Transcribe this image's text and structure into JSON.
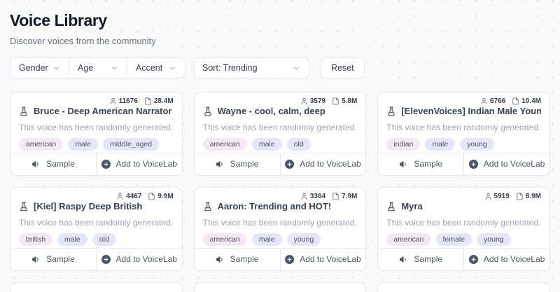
{
  "page": {
    "title": "Voice Library",
    "subtitle": "Discover voices from the community"
  },
  "filters": {
    "dropdowns": [
      {
        "label": "Gender"
      },
      {
        "label": "Age"
      },
      {
        "label": "Accent"
      }
    ],
    "sort": "Sort: Trending",
    "reset": "Reset"
  },
  "cards": {
    "description": "This voice has been randomly generated.",
    "sample_label": "Sample",
    "add_label": "Add to VoiceLab"
  },
  "voices": [
    {
      "name": "Bruce - Deep American Narrator Voice",
      "users": "11676",
      "plays": "28.4M",
      "tags": [
        {
          "label": "american",
          "variant": "pink"
        },
        {
          "label": "male",
          "variant": "purple"
        },
        {
          "label": "middle_aged",
          "variant": "purple"
        }
      ]
    },
    {
      "name": "Wayne - cool, calm, deep",
      "users": "3579",
      "plays": "5.8M",
      "tags": [
        {
          "label": "american",
          "variant": "pink"
        },
        {
          "label": "male",
          "variant": "purple"
        },
        {
          "label": "old",
          "variant": "purple"
        }
      ]
    },
    {
      "name": "[ElevenVoices] Indian Male Young",
      "users": "6766",
      "plays": "10.4M",
      "tags": [
        {
          "label": "indian",
          "variant": "pink"
        },
        {
          "label": "male",
          "variant": "purple"
        },
        {
          "label": "young",
          "variant": "purple"
        }
      ]
    },
    {
      "name": "[Kiel] Raspy Deep British",
      "users": "4467",
      "plays": "9.9M",
      "tags": [
        {
          "label": "british",
          "variant": "pink"
        },
        {
          "label": "male",
          "variant": "purple"
        },
        {
          "label": "old",
          "variant": "purple"
        }
      ]
    },
    {
      "name": "Aaron: Trending and HOT!",
      "users": "3364",
      "plays": "7.9M",
      "tags": [
        {
          "label": "american",
          "variant": "pink"
        },
        {
          "label": "male",
          "variant": "purple"
        },
        {
          "label": "young",
          "variant": "purple"
        }
      ]
    },
    {
      "name": "Myra",
      "users": "5919",
      "plays": "8.9M",
      "tags": [
        {
          "label": "american",
          "variant": "pink"
        },
        {
          "label": "female",
          "variant": "purple"
        },
        {
          "label": "young",
          "variant": "purple"
        }
      ]
    }
  ],
  "colors": {
    "tag_pink": "#f6e7f6",
    "tag_purple": "#e5e6fa",
    "background": "#f9fafb",
    "card_border": "#e5e7eb",
    "text_primary": "#374151",
    "text_muted": "#9ca3af"
  }
}
